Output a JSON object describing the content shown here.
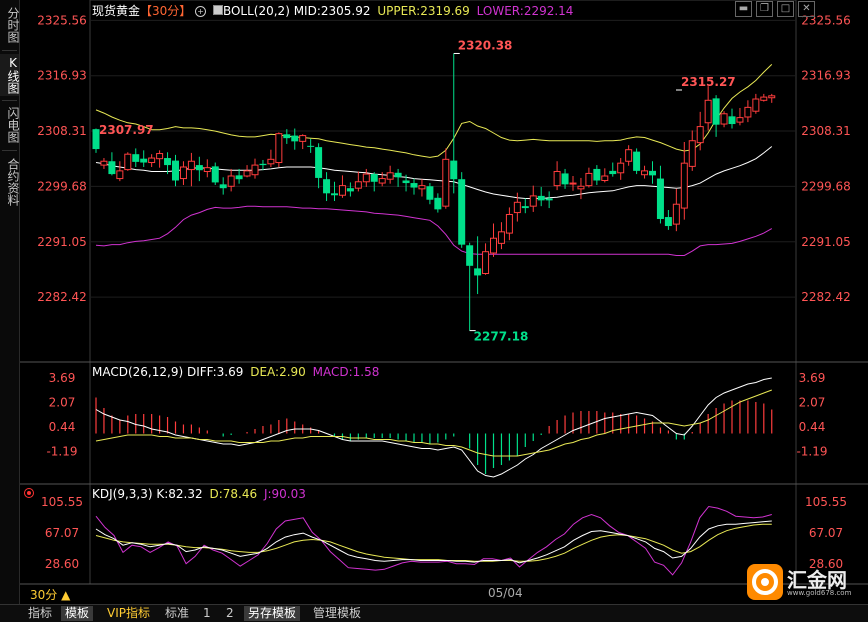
{
  "side_tabs": [
    "分时图",
    "K线图",
    "闪电图",
    "合约资料"
  ],
  "side_tab_active": 1,
  "header": {
    "instrument": "现货黄金",
    "period_tag": "【30分】",
    "period_icon": "circle-plus-icon",
    "boll_label": "BOLL(20,2)",
    "mid_label": "MID:2305.92",
    "upper_label": "UPPER:2319.69",
    "lower_label": "LOWER:2292.14"
  },
  "window_controls": [
    "minimize-icon",
    "restore-icon",
    "maximize-icon",
    "close-icon"
  ],
  "main_axis": {
    "ticks": [
      "2325.56",
      "2316.93",
      "2308.31",
      "2299.68",
      "2291.05",
      "2282.42"
    ]
  },
  "main_labels": {
    "high": "2320.38",
    "low": "2277.18",
    "left_mark": "2307.97",
    "right_mark": "2315.27"
  },
  "macd": {
    "label": "MACD(26,12,9)",
    "diff": "DIFF:3.69",
    "dea": "DEA:2.90",
    "macd": "MACD:1.58",
    "ticks": [
      "3.69",
      "2.07",
      "0.44",
      "-1.19"
    ]
  },
  "kdj": {
    "label": "KDJ(9,3,3)",
    "k": "K:82.32",
    "d": "D:78.46",
    "j": "J:90.03",
    "ticks": [
      "105.55",
      "67.07",
      "28.60"
    ]
  },
  "x_axis": {
    "date_label": "05/04"
  },
  "period_selector": "30分 ▲",
  "bottom_tabs": [
    "指标",
    "模板",
    "VIP指标",
    "标准",
    "1",
    "2",
    "另存模板",
    "管理模板"
  ],
  "bottom_tab_active": [
    1,
    6
  ],
  "logo": {
    "text": "汇金网",
    "url_text": "www.gold678.com"
  },
  "colors": {
    "up": "#ff3d3d",
    "down": "#00e08a",
    "upper": "#e8e855",
    "mid": "#ffffff",
    "lower": "#d033d0",
    "axis": "#ff5555",
    "kdj_k": "#ffffff",
    "kdj_d": "#e8e855",
    "kdj_j": "#d033d0"
  },
  "chart_data": {
    "type": "candlestick",
    "price_ylim": [
      2274.8,
      2327.8
    ],
    "candles": [
      [
        2308.6,
        2305.5,
        2308.7,
        2304.9
      ],
      [
        2303.0,
        2303.6,
        2304.1,
        2302.4
      ],
      [
        2303.6,
        2301.6,
        2305.0,
        2301.4
      ],
      [
        2300.9,
        2302.1,
        2303.6,
        2300.5
      ],
      [
        2302.3,
        2304.7,
        2305.0,
        2302.1
      ],
      [
        2304.7,
        2303.5,
        2305.6,
        2302.7
      ],
      [
        2304.0,
        2303.4,
        2305.3,
        2302.7
      ],
      [
        2303.4,
        2304.1,
        2304.7,
        2302.7
      ],
      [
        2304.0,
        2304.8,
        2305.3,
        2302.6
      ],
      [
        2304.1,
        2303.0,
        2305.0,
        2301.6
      ],
      [
        2303.7,
        2300.6,
        2304.6,
        2299.7
      ],
      [
        2300.9,
        2302.7,
        2303.6,
        2299.9
      ],
      [
        2302.3,
        2303.6,
        2304.9,
        2299.7
      ],
      [
        2303.0,
        2302.2,
        2304.3,
        2300.5
      ],
      [
        2302.0,
        2302.6,
        2303.9,
        2301.1
      ],
      [
        2302.8,
        2300.3,
        2303.4,
        2299.9
      ],
      [
        2300.0,
        2299.4,
        2301.1,
        2298.4
      ],
      [
        2299.7,
        2301.3,
        2302.4,
        2298.9
      ],
      [
        2301.4,
        2300.8,
        2302.4,
        2300.1
      ],
      [
        2301.3,
        2302.1,
        2303.0,
        2301.1
      ],
      [
        2301.5,
        2303.0,
        2304.0,
        2300.9
      ],
      [
        2303.2,
        2303.0,
        2303.8,
        2302.2
      ],
      [
        2303.2,
        2303.9,
        2305.4,
        2302.7
      ],
      [
        2303.4,
        2307.9,
        2308.1,
        2302.7
      ],
      [
        2307.8,
        2307.2,
        2308.6,
        2306.3
      ],
      [
        2307.6,
        2306.7,
        2308.7,
        2305.4
      ],
      [
        2306.7,
        2307.6,
        2307.8,
        2305.5
      ],
      [
        2306.0,
        2305.9,
        2307.1,
        2304.9
      ],
      [
        2305.8,
        2301.0,
        2306.4,
        2299.4
      ],
      [
        2300.8,
        2298.6,
        2301.9,
        2297.4
      ],
      [
        2298.6,
        2298.3,
        2300.4,
        2297.4
      ],
      [
        2298.3,
        2299.8,
        2301.4,
        2297.9
      ],
      [
        2299.4,
        2298.9,
        2300.3,
        2298.1
      ],
      [
        2299.4,
        2300.4,
        2302.0,
        2298.9
      ],
      [
        2300.4,
        2301.6,
        2302.4,
        2299.6
      ],
      [
        2301.6,
        2300.4,
        2301.9,
        2298.9
      ],
      [
        2300.2,
        2300.9,
        2301.9,
        2299.7
      ],
      [
        2300.8,
        2301.8,
        2302.9,
        2300.1
      ],
      [
        2301.8,
        2301.1,
        2302.4,
        2299.6
      ],
      [
        2300.6,
        2300.2,
        2301.5,
        2298.9
      ],
      [
        2300.2,
        2299.5,
        2300.9,
        2298.4
      ],
      [
        2299.3,
        2299.8,
        2300.8,
        2298.1
      ],
      [
        2299.7,
        2297.6,
        2300.2,
        2296.9
      ],
      [
        2297.9,
        2296.1,
        2298.6,
        2295.6
      ],
      [
        2296.6,
        2303.9,
        2305.6,
        2296.2
      ],
      [
        2303.7,
        2300.8,
        2320.4,
        2298.6
      ],
      [
        2300.8,
        2290.6,
        2301.9,
        2290.1
      ],
      [
        2290.5,
        2287.3,
        2290.9,
        2277.2
      ],
      [
        2286.9,
        2285.8,
        2291.9,
        2282.9
      ],
      [
        2286.1,
        2289.5,
        2290.8,
        2285.9
      ],
      [
        2289.3,
        2291.6,
        2293.9,
        2288.7
      ],
      [
        2290.8,
        2292.6,
        2294.1,
        2289.9
      ],
      [
        2292.4,
        2295.3,
        2296.4,
        2291.3
      ],
      [
        2295.6,
        2297.2,
        2298.7,
        2294.2
      ],
      [
        2296.6,
        2296.3,
        2297.8,
        2295.5
      ],
      [
        2296.6,
        2298.2,
        2299.8,
        2295.7
      ],
      [
        2298.2,
        2297.5,
        2299.6,
        2296.6
      ],
      [
        2297.8,
        2297.5,
        2298.9,
        2296.3
      ],
      [
        2299.8,
        2302.0,
        2303.6,
        2299.1
      ],
      [
        2301.7,
        2300.0,
        2302.4,
        2299.3
      ],
      [
        2300.1,
        2300.2,
        2301.3,
        2299.0
      ],
      [
        2299.3,
        2299.7,
        2301.0,
        2297.7
      ],
      [
        2299.8,
        2301.7,
        2302.6,
        2299.5
      ],
      [
        2302.4,
        2300.6,
        2303.0,
        2299.9
      ],
      [
        2300.6,
        2301.3,
        2302.5,
        2300.3
      ],
      [
        2302.1,
        2301.6,
        2303.4,
        2301.2
      ],
      [
        2301.8,
        2303.3,
        2304.1,
        2300.7
      ],
      [
        2303.6,
        2305.4,
        2306.1,
        2302.9
      ],
      [
        2305.1,
        2302.1,
        2305.6,
        2301.6
      ],
      [
        2301.5,
        2302.1,
        2302.9,
        2300.9
      ],
      [
        2302.1,
        2301.4,
        2303.6,
        2300.1
      ],
      [
        2300.9,
        2294.6,
        2302.9,
        2293.9
      ],
      [
        2294.9,
        2293.5,
        2296.0,
        2292.9
      ],
      [
        2293.8,
        2296.9,
        2299.3,
        2292.7
      ],
      [
        2296.3,
        2303.3,
        2306.6,
        2294.5
      ],
      [
        2302.8,
        2306.8,
        2308.4,
        2302.1
      ],
      [
        2306.5,
        2309.0,
        2311.3,
        2305.3
      ],
      [
        2309.6,
        2313.1,
        2315.3,
        2308.4
      ],
      [
        2313.4,
        2309.3,
        2313.9,
        2307.4
      ],
      [
        2309.4,
        2311.0,
        2311.4,
        2308.9
      ],
      [
        2310.6,
        2309.4,
        2311.8,
        2308.7
      ],
      [
        2309.7,
        2310.4,
        2311.9,
        2309.2
      ],
      [
        2310.5,
        2312.0,
        2313.1,
        2309.7
      ],
      [
        2311.4,
        2313.3,
        2314.1,
        2311.0
      ],
      [
        2313.1,
        2313.6,
        2314.1,
        2312.9
      ],
      [
        2313.5,
        2313.8,
        2314.1,
        2312.7
      ]
    ],
    "boll_upper": [
      2311.6,
      2311.1,
      2310.5,
      2310.0,
      2309.6,
      2309.4,
      2309.0,
      2308.5,
      2308.5,
      2308.7,
      2309.0,
      2308.8,
      2308.8,
      2308.7,
      2308.5,
      2308.3,
      2308.0,
      2307.7,
      2307.5,
      2307.4,
      2307.4,
      2307.6,
      2307.8,
      2307.7,
      2307.5,
      2307.4,
      2307.3,
      2307.2,
      2307.1,
      2306.8,
      2306.6,
      2306.4,
      2306.2,
      2306.0,
      2305.8,
      2305.7,
      2305.5,
      2305.3,
      2305.1,
      2304.9,
      2304.6,
      2304.4,
      2304.2,
      2304.4,
      2305.3,
      2307.2,
      2309.5,
      2309.8,
      2309.1,
      2308.7,
      2308.0,
      2307.3,
      2306.9,
      2306.8,
      2306.9,
      2307.0,
      2306.9,
      2306.8,
      2306.8,
      2306.8,
      2306.8,
      2306.8,
      2306.8,
      2306.7,
      2306.8,
      2306.8,
      2306.9,
      2307.2,
      2307.4,
      2307.3,
      2306.9,
      2306.5,
      2306.0,
      2305.5,
      2305.2,
      2305.4,
      2306.3,
      2308.0,
      2310.1,
      2311.9,
      2313.4,
      2314.4,
      2315.2,
      2316.2,
      2317.5,
      2318.7
    ],
    "boll_mid": [
      2303.4,
      2303.2,
      2302.9,
      2302.7,
      2302.5,
      2302.3,
      2302.2,
      2302.0,
      2302.0,
      2302.0,
      2302.1,
      2302.3,
      2302.5,
      2302.6,
      2302.5,
      2302.4,
      2302.3,
      2302.2,
      2302.2,
      2302.2,
      2302.2,
      2302.3,
      2302.4,
      2302.6,
      2302.7,
      2302.7,
      2302.7,
      2302.7,
      2302.6,
      2302.4,
      2302.2,
      2302.1,
      2302.0,
      2301.9,
      2301.8,
      2301.6,
      2301.5,
      2301.4,
      2301.2,
      2301.1,
      2300.9,
      2300.8,
      2300.7,
      2300.6,
      2300.5,
      2300.4,
      2300.0,
      2299.6,
      2299.2,
      2298.8,
      2298.5,
      2298.3,
      2298.1,
      2297.9,
      2297.8,
      2297.8,
      2297.8,
      2297.9,
      2298.0,
      2298.2,
      2298.3,
      2298.5,
      2298.7,
      2298.8,
      2298.9,
      2299.0,
      2299.3,
      2299.6,
      2299.8,
      2299.8,
      2299.7,
      2299.6,
      2299.5,
      2299.4,
      2299.5,
      2299.8,
      2300.2,
      2300.9,
      2301.6,
      2302.1,
      2302.5,
      2302.9,
      2303.4,
      2304.0,
      2304.9,
      2305.9
    ],
    "boll_lower": [
      2290.5,
      2290.4,
      2290.6,
      2290.6,
      2290.9,
      2291.1,
      2291.2,
      2291.4,
      2291.6,
      2292.3,
      2293.3,
      2294.5,
      2295.2,
      2295.6,
      2296.1,
      2296.4,
      2296.3,
      2296.3,
      2296.4,
      2296.6,
      2296.6,
      2296.5,
      2296.5,
      2296.5,
      2296.5,
      2296.4,
      2296.3,
      2296.3,
      2296.2,
      2296.2,
      2296.1,
      2296.0,
      2295.9,
      2295.8,
      2295.7,
      2295.5,
      2295.4,
      2295.3,
      2295.2,
      2295.0,
      2294.8,
      2294.6,
      2294.4,
      2293.5,
      2292.2,
      2290.5,
      2289.6,
      2289.2,
      2289.1,
      2289.1,
      2289.1,
      2289.1,
      2289.1,
      2289.1,
      2289.1,
      2289.1,
      2289.1,
      2289.1,
      2289.1,
      2289.1,
      2289.1,
      2289.1,
      2289.1,
      2289.1,
      2289.1,
      2289.1,
      2289.1,
      2289.1,
      2289.1,
      2289.1,
      2289.1,
      2289.1,
      2289.1,
      2288.9,
      2288.9,
      2289.6,
      2290.4,
      2290.6,
      2290.6,
      2290.7,
      2290.8,
      2291.1,
      2291.5,
      2291.9,
      2292.4,
      2293.1
    ],
    "macd_ylim": [
      -3.3,
      4.3
    ],
    "macd_hist": [
      2.4,
      1.7,
      1.2,
      0.9,
      1.2,
      1.3,
      1.3,
      1.3,
      1.2,
      1.1,
      0.8,
      0.6,
      0.6,
      0.4,
      0.2,
      0.0,
      -0.2,
      -0.1,
      0.0,
      0.1,
      0.3,
      0.5,
      0.6,
      0.9,
      1.0,
      0.8,
      0.6,
      0.4,
      0.2,
      0.0,
      -0.2,
      -0.4,
      -0.5,
      -0.4,
      -0.3,
      -0.3,
      -0.3,
      -0.3,
      -0.4,
      -0.5,
      -0.6,
      -0.6,
      -0.7,
      -0.6,
      -0.4,
      -0.2,
      0.0,
      -1.0,
      -2.1,
      -2.7,
      -2.3,
      -2.1,
      -1.8,
      -1.5,
      -0.9,
      -0.5,
      -0.1,
      0.5,
      0.9,
      1.2,
      1.4,
      1.5,
      1.5,
      1.5,
      1.4,
      1.4,
      1.3,
      1.3,
      1.2,
      1.0,
      0.8,
      0.4,
      0.2,
      -0.4,
      -0.4,
      0.1,
      0.7,
      1.3,
      1.7,
      2.0,
      2.2,
      2.2,
      2.2,
      2.1,
      2.0,
      1.6
    ],
    "macd_diff": [
      1.6,
      1.3,
      1.1,
      0.9,
      0.8,
      0.6,
      0.5,
      0.3,
      0.2,
      0.1,
      -0.1,
      -0.2,
      -0.3,
      -0.4,
      -0.5,
      -0.6,
      -0.7,
      -0.7,
      -0.8,
      -0.7,
      -0.6,
      -0.4,
      -0.2,
      0.0,
      0.2,
      0.3,
      0.3,
      0.3,
      0.2,
      0.0,
      -0.2,
      -0.4,
      -0.5,
      -0.5,
      -0.5,
      -0.5,
      -0.5,
      -0.6,
      -0.7,
      -0.8,
      -0.9,
      -1.0,
      -1.0,
      -1.1,
      -1.0,
      -0.9,
      -1.1,
      -1.8,
      -2.5,
      -2.8,
      -2.9,
      -2.7,
      -2.4,
      -2.1,
      -1.7,
      -1.4,
      -1.0,
      -0.7,
      -0.4,
      -0.1,
      0.2,
      0.4,
      0.6,
      0.8,
      1.0,
      1.1,
      1.2,
      1.3,
      1.4,
      1.3,
      1.2,
      0.8,
      0.4,
      0.0,
      -0.1,
      0.5,
      1.2,
      1.9,
      2.4,
      2.7,
      2.9,
      3.1,
      3.3,
      3.4,
      3.6,
      3.7
    ],
    "macd_dea": [
      -0.5,
      -0.4,
      -0.3,
      -0.2,
      -0.1,
      -0.1,
      -0.1,
      -0.1,
      -0.2,
      -0.2,
      -0.3,
      -0.3,
      -0.3,
      -0.4,
      -0.4,
      -0.5,
      -0.5,
      -0.5,
      -0.6,
      -0.6,
      -0.6,
      -0.6,
      -0.5,
      -0.5,
      -0.4,
      -0.3,
      -0.3,
      -0.2,
      -0.2,
      -0.2,
      -0.2,
      -0.2,
      -0.3,
      -0.3,
      -0.3,
      -0.4,
      -0.4,
      -0.4,
      -0.5,
      -0.5,
      -0.6,
      -0.6,
      -0.7,
      -0.7,
      -0.8,
      -0.8,
      -0.9,
      -1.1,
      -1.3,
      -1.4,
      -1.5,
      -1.5,
      -1.5,
      -1.5,
      -1.4,
      -1.3,
      -1.2,
      -1.1,
      -0.9,
      -0.7,
      -0.6,
      -0.4,
      -0.3,
      -0.1,
      0.0,
      0.2,
      0.3,
      0.4,
      0.5,
      0.6,
      0.7,
      0.7,
      0.7,
      0.6,
      0.5,
      0.6,
      0.7,
      0.9,
      1.2,
      1.5,
      1.8,
      2.1,
      2.3,
      2.5,
      2.7,
      2.9
    ],
    "kdj_ylim": [
      5,
      118
    ],
    "kdj_k": [
      72,
      65,
      60,
      52,
      55,
      53,
      50,
      52,
      54,
      52,
      44,
      46,
      50,
      48,
      46,
      42,
      38,
      40,
      42,
      48,
      56,
      62,
      65,
      67,
      62,
      58,
      52,
      46,
      40,
      37,
      35,
      33,
      32,
      33,
      34,
      34,
      33,
      33,
      33,
      33,
      32,
      32,
      31,
      33,
      33,
      33,
      34,
      30,
      33,
      36,
      40,
      45,
      50,
      58,
      64,
      69,
      70,
      68,
      66,
      64,
      60,
      56,
      48,
      44,
      36,
      38,
      48,
      62,
      72,
      76,
      78,
      78,
      79,
      80,
      81,
      82
    ],
    "kdj_d": [
      64,
      61,
      58,
      56,
      55,
      54,
      53,
      53,
      53,
      52,
      50,
      49,
      49,
      48,
      47,
      45,
      44,
      43,
      43,
      45,
      48,
      52,
      56,
      58,
      59,
      58,
      56,
      52,
      48,
      44,
      41,
      39,
      37,
      36,
      35,
      34,
      34,
      34,
      34,
      33,
      33,
      33,
      32,
      32,
      32,
      33,
      33,
      32,
      32,
      33,
      35,
      38,
      42,
      48,
      53,
      58,
      62,
      64,
      65,
      64,
      62,
      60,
      56,
      52,
      46,
      42,
      44,
      50,
      58,
      65,
      70,
      73,
      75,
      77,
      78,
      78
    ],
    "kdj_j": [
      88,
      74,
      64,
      43,
      52,
      50,
      43,
      49,
      56,
      51,
      29,
      38,
      52,
      46,
      42,
      34,
      26,
      33,
      40,
      54,
      72,
      82,
      84,
      86,
      68,
      58,
      44,
      34,
      24,
      23,
      22,
      21,
      22,
      26,
      30,
      32,
      31,
      31,
      31,
      32,
      29,
      29,
      28,
      35,
      35,
      33,
      36,
      25,
      34,
      43,
      50,
      59,
      66,
      78,
      86,
      90,
      86,
      76,
      68,
      64,
      56,
      48,
      31,
      27,
      15,
      30,
      56,
      86,
      100,
      98,
      94,
      88,
      87,
      86,
      87,
      90
    ]
  }
}
